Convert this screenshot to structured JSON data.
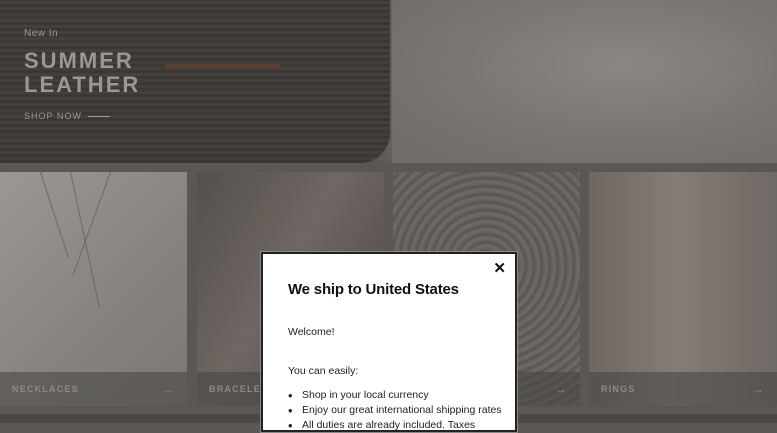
{
  "hero": {
    "kicker": "New In",
    "title_line1": "SUMMER",
    "title_line2": "LEATHER",
    "link": "SHOP NOW"
  },
  "tiles": [
    {
      "label": "NECKLACES"
    },
    {
      "label": "BRACELETS"
    },
    {
      "label": ""
    },
    {
      "label": "RINGS"
    }
  ],
  "modal": {
    "title": "We ship to United States",
    "welcome": "Welcome!",
    "easily": "You can easily:",
    "items": [
      "Shop in your local currency",
      "Enjoy our great international shipping rates",
      "All duties are already included. Taxes"
    ],
    "close_icon": "close-icon"
  }
}
